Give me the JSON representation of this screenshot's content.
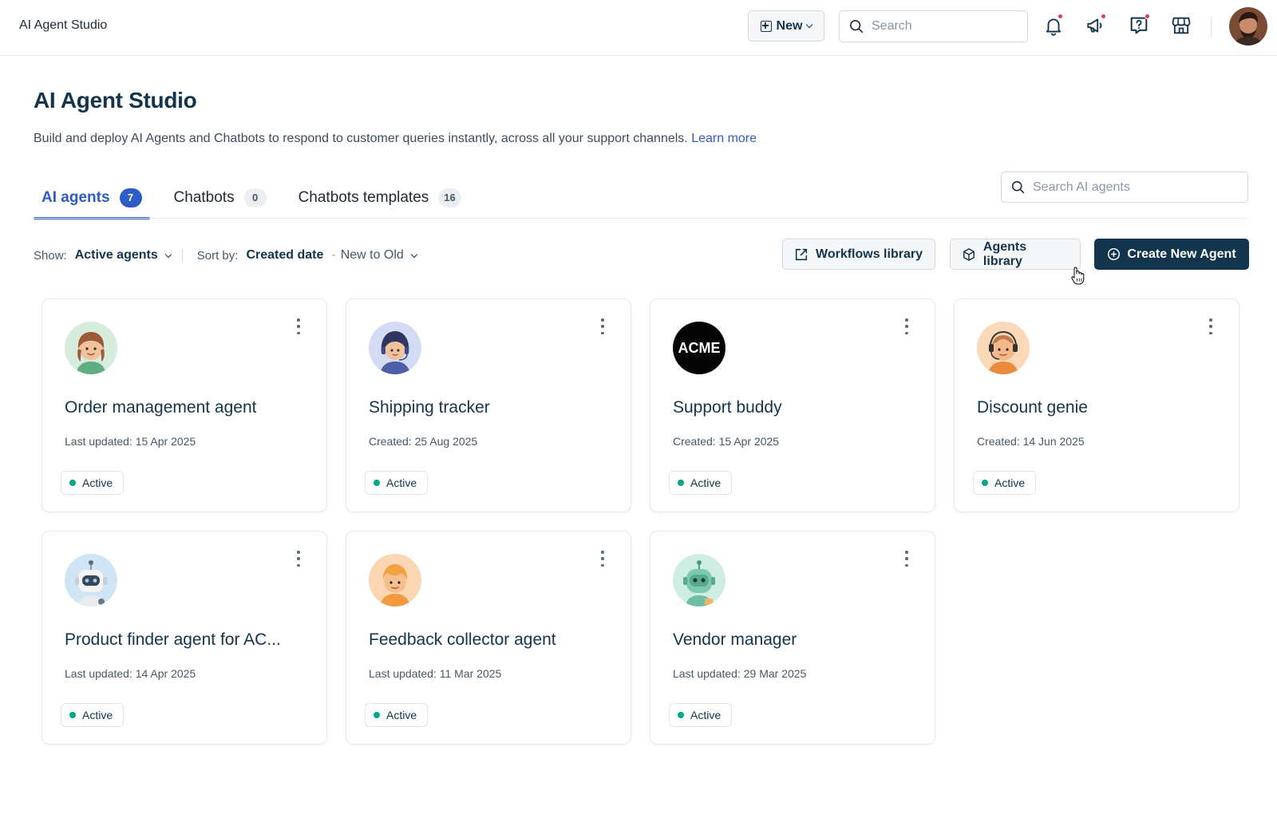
{
  "app": {
    "title": "AI Agent Studio"
  },
  "topbar": {
    "new_label": "New",
    "search_placeholder": "Search"
  },
  "header": {
    "title": "AI Agent Studio",
    "description": "Build and deploy AI Agents and Chatbots to respond to customer queries instantly, across all your support channels.",
    "learn_more": "Learn more"
  },
  "tabs": [
    {
      "label": "AI agents",
      "count": "7"
    },
    {
      "label": "Chatbots",
      "count": "0"
    },
    {
      "label": "Chatbots templates",
      "count": "16"
    }
  ],
  "agent_search": {
    "placeholder": "Search AI agents"
  },
  "filters": {
    "show_label": "Show:",
    "show_value": "Active agents",
    "sort_label": "Sort by:",
    "sort_value": "Created date",
    "sort_separator": "-",
    "sort_order": "New to Old"
  },
  "actions": {
    "workflows": "Workflows library",
    "agents": "Agents library",
    "create": "Create New Agent"
  },
  "agents": [
    {
      "name": "Order management agent",
      "date": "Last updated: 15 Apr 2025",
      "status": "Active",
      "avatar": "woman-avatar-icon"
    },
    {
      "name": "Shipping tracker",
      "date": "Created: 25 Aug 2025",
      "status": "Active",
      "avatar": "headset-woman-avatar-icon"
    },
    {
      "name": "Support buddy",
      "date": "Created: 15 Apr 2025",
      "status": "Active",
      "avatar": "acme-logo",
      "avatar_text": "ACME"
    },
    {
      "name": "Discount genie",
      "date": "Created: 14 Jun 2025",
      "status": "Active",
      "avatar": "headset-man-avatar-icon"
    },
    {
      "name": "Product finder agent for AC...",
      "date": "Last updated: 14 Apr 2025",
      "status": "Active",
      "avatar": "robot-avatar-icon"
    },
    {
      "name": "Feedback collector agent",
      "date": "Last updated: 11 Mar 2025",
      "status": "Active",
      "avatar": "boy-avatar-icon"
    },
    {
      "name": "Vendor manager",
      "date": "Last updated: 29 Mar 2025",
      "status": "Active",
      "avatar": "green-robot-avatar-icon"
    }
  ],
  "colors": {
    "primary": "#12344d",
    "accent": "#2c5cc5",
    "active_green": "#00a886",
    "notification_red": "#e8384f"
  }
}
